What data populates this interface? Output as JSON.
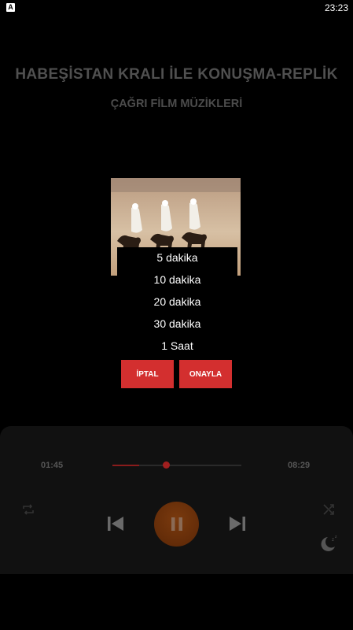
{
  "statusbar": {
    "app_icon_letter": "A",
    "time": "23:23"
  },
  "track": {
    "title": "HABEŞİSTAN KRALI İLE KONUŞMA-REPLİK",
    "artist": "ÇAĞRI FİLM MÜZİKLERİ"
  },
  "sleep_timer": {
    "options": [
      "5 dakika",
      "10 dakika",
      "20 dakika",
      "30 dakika",
      "1 Saat"
    ],
    "cancel_label": "İPTAL",
    "confirm_label": "ONAYLA"
  },
  "player": {
    "current_time": "01:45",
    "duration": "08:29",
    "progress_fraction": 0.206,
    "icons": [
      "repeat-icon",
      "shuffle-icon",
      "previous-icon",
      "pause-icon",
      "next-icon",
      "sleep-timer-icon"
    ]
  },
  "colors": {
    "accent": "#d32f2f",
    "play_button": "#6b300a",
    "muted_text": "#555555"
  }
}
